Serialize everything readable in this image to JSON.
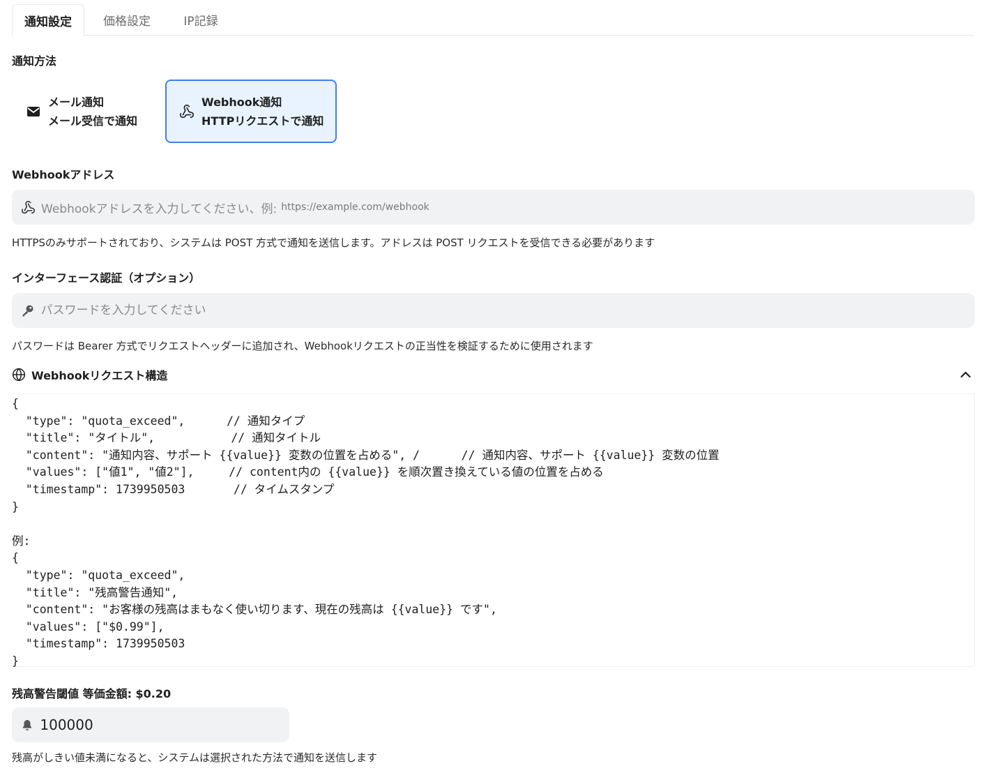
{
  "tabs": [
    "通知設定",
    "価格設定",
    "IP記録"
  ],
  "method_section": {
    "label": "通知方法",
    "options": [
      {
        "title": "メール通知",
        "subtitle": "メール受信で通知",
        "icon": "envelope-icon",
        "selected": false
      },
      {
        "title": "Webhook通知",
        "subtitle": "HTTPリクエストで通知",
        "icon": "webhook-icon",
        "selected": true
      }
    ]
  },
  "webhook_address": {
    "label": "Webhookアドレス",
    "placeholder_main": "Webhookアドレスを入力してください、例:",
    "placeholder_url": "https://example.com/webhook",
    "value": "",
    "hint": "HTTPSのみサポートされており、システムは POST 方式で通知を送信します。アドレスは POST リクエストを受信できる必要があります"
  },
  "auth": {
    "label": "インターフェース認証（オプション）",
    "placeholder": "パスワードを入力してください",
    "value": "",
    "hint": "パスワードは Bearer 方式でリクエストヘッダーに追加され、Webhookリクエストの正当性を検証するために使用されます"
  },
  "request_structure": {
    "title": "Webhookリクエスト構造",
    "expanded": true,
    "code": "{\n  \"type\": \"quota_exceed\",      // 通知タイプ\n  \"title\": \"タイトル\",           // 通知タイトル\n  \"content\": \"通知内容、サポート {{value}} 変数の位置を占める\", /      // 通知内容、サポート {{value}} 変数の位置\n  \"values\": [\"値1\", \"値2\"],     // content内の {{value}} を順次置き換えている値の位置を占める\n  \"timestamp\": 1739950503       // タイムスタンプ\n}\n\n例:\n{\n  \"type\": \"quota_exceed\",\n  \"title\": \"残高警告通知\",\n  \"content\": \"お客様の残高はまもなく使い切ります、現在の残高は {{value}} です\",\n  \"values\": [\"$0.99\"],\n  \"timestamp\": 1739950503\n}"
  },
  "threshold": {
    "label": "残高警告閾値 等価金額: $0.20",
    "value": "100000",
    "hint": "残高がしきい値未満になると、システムは選択された方法で通知を送信します"
  },
  "colors": {
    "accent": "#3d7ff0",
    "selected_bg": "#e8f3ff",
    "input_bg": "#f1f2f4"
  }
}
